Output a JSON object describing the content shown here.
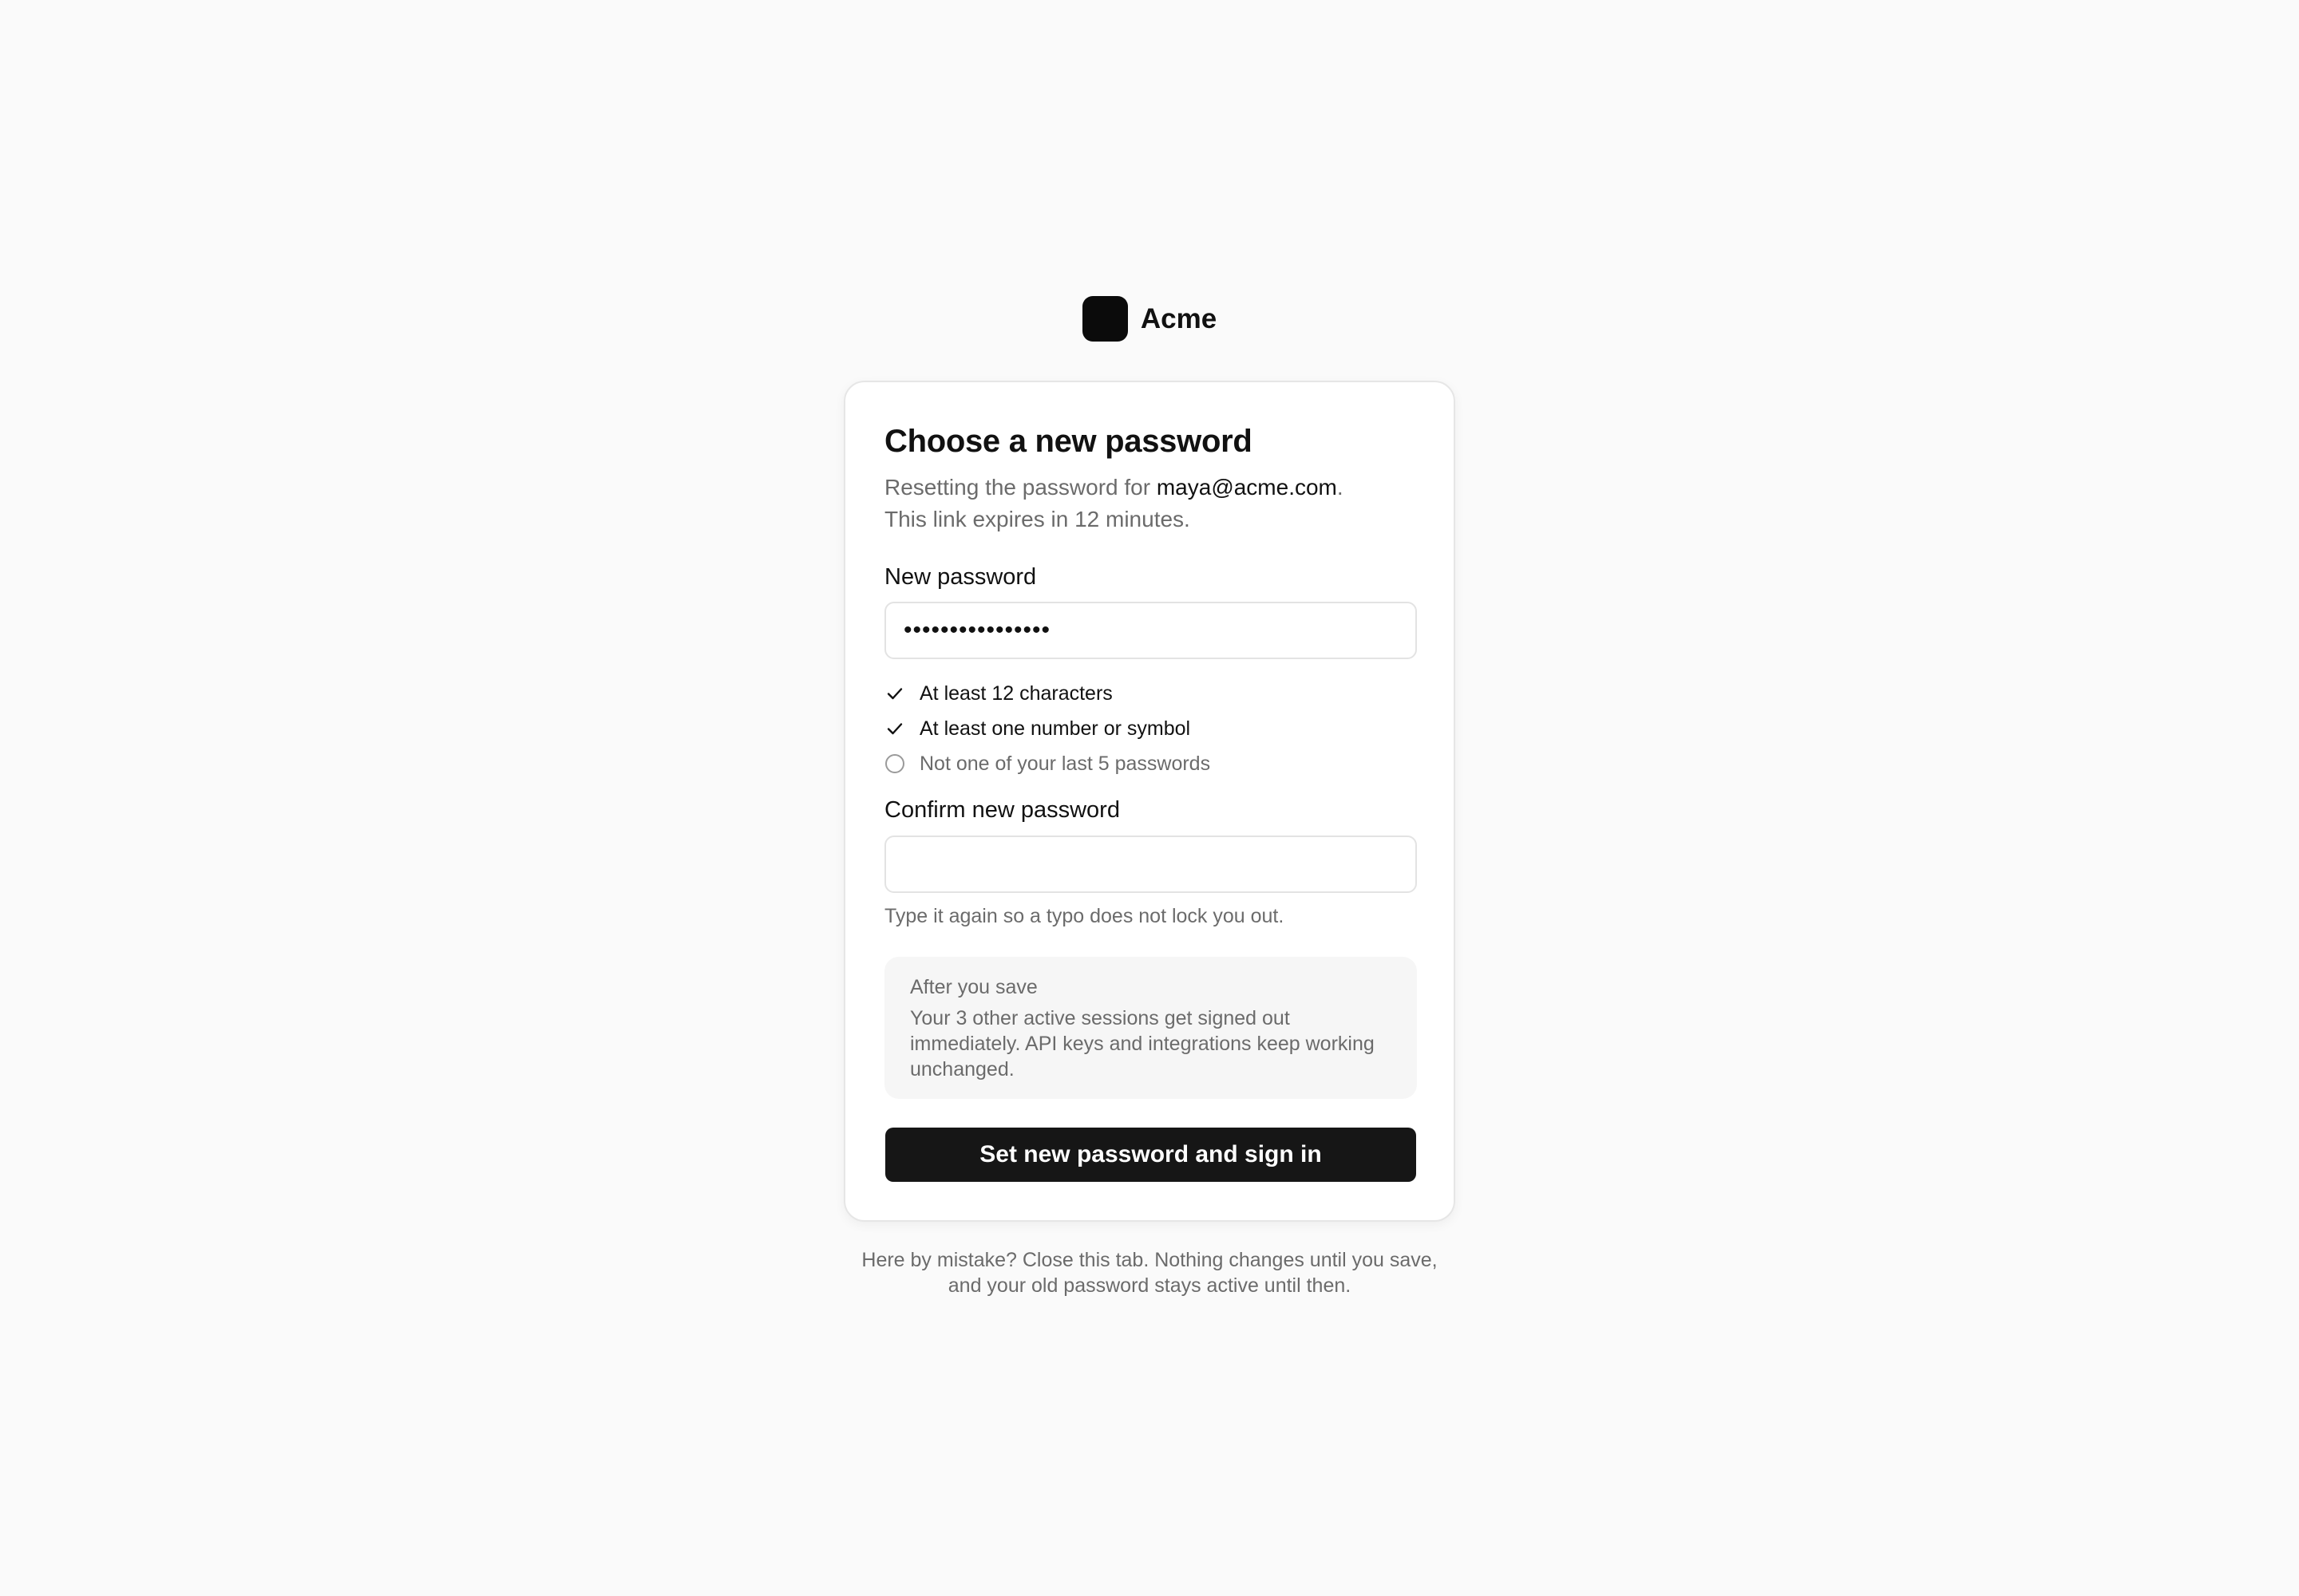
{
  "brand": {
    "name": "Acme",
    "mark_color": "#0b0b0b"
  },
  "card": {
    "title": "Choose a new password",
    "subtitle_prefix": "Resetting the password for ",
    "email": "maya@acme.com",
    "subtitle_suffix": ".",
    "expiry_text": "This link expires in 12 minutes."
  },
  "new_password": {
    "label": "New password",
    "value": "••••••••••••••••",
    "requirements": [
      {
        "text": "At least 12 characters",
        "met": true,
        "icon": "check-icon"
      },
      {
        "text": "At least one number or symbol",
        "met": true,
        "icon": "check-icon"
      },
      {
        "text": "Not one of your last 5 passwords",
        "met": false,
        "icon": "circle-icon"
      }
    ]
  },
  "confirm_password": {
    "label": "Confirm new password",
    "value": "",
    "hint": "Type it again so a typo does not lock you out."
  },
  "notice": {
    "title": "After you save",
    "body": "Your 3 other active sessions get signed out immediately. API keys and integrations keep working unchanged."
  },
  "submit_label": "Set new password and sign in",
  "footer": {
    "line1": "Here by mistake? Close this tab. Nothing changes until you save,",
    "line2": "and your old password stays active until then."
  },
  "colors": {
    "background": "#fafafa",
    "primary_button": "#161616",
    "muted_text": "#6b6b6b"
  }
}
